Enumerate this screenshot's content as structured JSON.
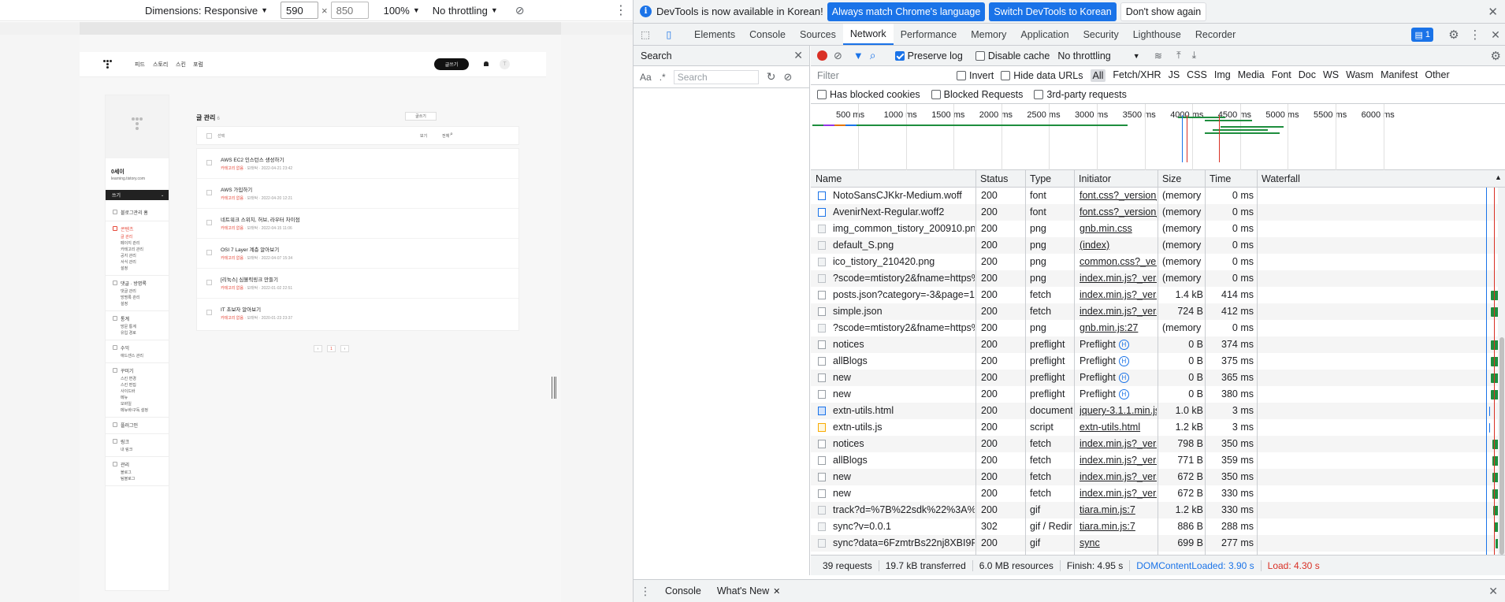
{
  "device_toolbar": {
    "dimensions_label": "Dimensions: Responsive",
    "width_value": "590",
    "height_placeholder": "850",
    "zoom": "100%",
    "throttling": "No throttling"
  },
  "tistory": {
    "nav": [
      "피드",
      "스토리",
      "스킨",
      "포럼"
    ],
    "write_button": "글쓰기",
    "avatar_letter": "T",
    "blog_name": "0세이",
    "blog_url": "learning.tistory.com",
    "write_bar": "쓰기",
    "sidebar": [
      {
        "title": "블로그관리 홈",
        "items": []
      },
      {
        "title": "콘텐츠",
        "active": true,
        "items": [
          "글 관리",
          "페이지 관리",
          "카테고리 관리",
          "공지 관리",
          "서식 관리",
          "설정"
        ]
      },
      {
        "title": "댓글 · 방명록",
        "items": [
          "댓글 관리",
          "방명록 관리",
          "설정"
        ]
      },
      {
        "title": "통계",
        "items": [
          "방문 통계",
          "유입 경로"
        ]
      },
      {
        "title": "수익",
        "items": [
          "애드센스 관리"
        ]
      },
      {
        "title": "꾸미기",
        "items": [
          "스킨 변경",
          "스킨 편집",
          "사이드바",
          "메뉴",
          "모바일",
          "메뉴바/구독 설정"
        ]
      },
      {
        "title": "플러그인",
        "items": []
      },
      {
        "title": "링크",
        "items": [
          "내 링크"
        ]
      },
      {
        "title": "관리",
        "items": [
          "블로그",
          "팀블로그"
        ]
      }
    ],
    "main_title": "글 관리",
    "main_count": "6",
    "sort_button": "글쓰기",
    "list_head": {
      "select": "선택",
      "view": "보기",
      "all": "전체"
    },
    "posts": [
      {
        "title": "AWS EC2 인스턴스 생성하기",
        "category": "카테고리 없음",
        "author": "모래탁",
        "date": "2022-04-21 23:42"
      },
      {
        "title": "AWS 가입하기",
        "category": "카테고리 없음",
        "author": "모래탁",
        "date": "2022-04-20 12:21"
      },
      {
        "title": "네트워크 스위치, 허브, 라우터 차이점",
        "category": "카테고리 없음",
        "author": "모래탁",
        "date": "2022-04-15 11:06"
      },
      {
        "title": "OSI 7 Layer 계층 알아보기",
        "category": "카테고리 없음",
        "author": "모래탁",
        "date": "2022-04-07 15:34"
      },
      {
        "title": "[리눅스] 심볼릭링크 만들기",
        "category": "카테고리 없음",
        "author": "모래탁",
        "date": "2022-01-02 22:51"
      },
      {
        "title": "IT 초보자 알아보기",
        "category": "카테고리 없음",
        "author": "모래탁",
        "date": "2020-01-23 23:37"
      }
    ],
    "pager": [
      "‹",
      "1",
      "›"
    ]
  },
  "infobar": {
    "message": "DevTools is now available in Korean!",
    "btn_match": "Always match Chrome's language",
    "btn_switch": "Switch DevTools to Korean",
    "btn_dismiss": "Don't show again"
  },
  "tabs": [
    "Elements",
    "Console",
    "Sources",
    "Network",
    "Performance",
    "Memory",
    "Application",
    "Security",
    "Lighthouse",
    "Recorder"
  ],
  "active_tab": "Network",
  "message_count": "1",
  "search_panel": {
    "title": "Search",
    "aa": "Aa",
    "regex": ".*",
    "placeholder": "Search"
  },
  "network_toolbar": {
    "preserve_log": "Preserve log",
    "disable_cache": "Disable cache",
    "throttling": "No throttling"
  },
  "filter": {
    "placeholder": "Filter",
    "invert": "Invert",
    "hide_data_urls": "Hide data URLs",
    "types": [
      "All",
      "Fetch/XHR",
      "JS",
      "CSS",
      "Img",
      "Media",
      "Font",
      "Doc",
      "WS",
      "Wasm",
      "Manifest",
      "Other"
    ],
    "has_blocked_cookies": "Has blocked cookies",
    "blocked_requests": "Blocked Requests",
    "third_party": "3rd-party requests"
  },
  "overview_ticks": [
    "500 ms",
    "1000 ms",
    "1500 ms",
    "2000 ms",
    "2500 ms",
    "3000 ms",
    "3500 ms",
    "4000 ms",
    "4500 ms",
    "5000 ms",
    "5500 ms",
    "6000 ms"
  ],
  "columns": {
    "name": "Name",
    "status": "Status",
    "type": "Type",
    "initiator": "Initiator",
    "size": "Size",
    "time": "Time",
    "waterfall": "Waterfall"
  },
  "requests": [
    {
      "name": "NotoSansCJKkr-Medium.woff",
      "status": "200",
      "type": "font",
      "initiator": "font.css?_version_=ti...",
      "size": "(memory c...",
      "time": "0 ms",
      "icon": "font"
    },
    {
      "name": "AvenirNext-Regular.woff2",
      "status": "200",
      "type": "font",
      "initiator": "font.css?_version_=ti...",
      "size": "(memory c...",
      "time": "0 ms",
      "icon": "font"
    },
    {
      "name": "img_common_tistory_200910.png",
      "status": "200",
      "type": "png",
      "initiator": "gnb.min.css",
      "size": "(memory c...",
      "time": "0 ms",
      "icon": "img"
    },
    {
      "name": "default_S.png",
      "status": "200",
      "type": "png",
      "initiator": "(index)",
      "size": "(memory c...",
      "time": "0 ms",
      "icon": "img"
    },
    {
      "name": "ico_tistory_210420.png",
      "status": "200",
      "type": "png",
      "initiator": "common.css?_versio...",
      "size": "(memory c...",
      "time": "0 ms",
      "icon": "img"
    },
    {
      "name": "?scode=mtistory2&fname=https%3A%2...",
      "status": "200",
      "type": "png",
      "initiator": "index.min.js?_versio...",
      "size": "(memory c...",
      "time": "0 ms",
      "icon": "img"
    },
    {
      "name": "posts.json?category=-3&page=1&searc...",
      "status": "200",
      "type": "fetch",
      "initiator": "index.min.js?_versio...",
      "size": "1.4 kB",
      "time": "414 ms",
      "icon": "plain"
    },
    {
      "name": "simple.json",
      "status": "200",
      "type": "fetch",
      "initiator": "index.min.js?_versio...",
      "size": "724 B",
      "time": "412 ms",
      "icon": "plain"
    },
    {
      "name": "?scode=mtistory2&fname=https%3A%2...",
      "status": "200",
      "type": "png",
      "initiator": "gnb.min.js:27",
      "size": "(memory c...",
      "time": "0 ms",
      "icon": "img"
    },
    {
      "name": "notices",
      "status": "200",
      "type": "preflight",
      "initiator": "Preflight",
      "size": "0 B",
      "time": "374 ms",
      "icon": "plain"
    },
    {
      "name": "allBlogs",
      "status": "200",
      "type": "preflight",
      "initiator": "Preflight",
      "size": "0 B",
      "time": "375 ms",
      "icon": "plain"
    },
    {
      "name": "new",
      "status": "200",
      "type": "preflight",
      "initiator": "Preflight",
      "size": "0 B",
      "time": "365 ms",
      "icon": "plain"
    },
    {
      "name": "new",
      "status": "200",
      "type": "preflight",
      "initiator": "Preflight",
      "size": "0 B",
      "time": "380 ms",
      "icon": "plain"
    },
    {
      "name": "extn-utils.html",
      "status": "200",
      "type": "document",
      "initiator": "jquery-3.1.1.min.js:3",
      "size": "1.0 kB",
      "time": "3 ms",
      "icon": "doc"
    },
    {
      "name": "extn-utils.js",
      "status": "200",
      "type": "script",
      "initiator": "extn-utils.html",
      "size": "1.2 kB",
      "time": "3 ms",
      "icon": "script"
    },
    {
      "name": "notices",
      "status": "200",
      "type": "fetch",
      "initiator": "index.min.js?_versio...",
      "size": "798 B",
      "time": "350 ms",
      "icon": "plain"
    },
    {
      "name": "allBlogs",
      "status": "200",
      "type": "fetch",
      "initiator": "index.min.js?_versio...",
      "size": "771 B",
      "time": "359 ms",
      "icon": "plain"
    },
    {
      "name": "new",
      "status": "200",
      "type": "fetch",
      "initiator": "index.min.js?_versio...",
      "size": "672 B",
      "time": "350 ms",
      "icon": "plain"
    },
    {
      "name": "new",
      "status": "200",
      "type": "fetch",
      "initiator": "index.min.js?_versio...",
      "size": "672 B",
      "time": "330 ms",
      "icon": "plain"
    },
    {
      "name": "track?d=%7B%22sdk%22%3A%7B%22ty...",
      "status": "200",
      "type": "gif",
      "initiator": "tiara.min.js:7",
      "size": "1.2 kB",
      "time": "330 ms",
      "icon": "img"
    },
    {
      "name": "sync?v=0.0.1",
      "status": "302",
      "type": "gif / Redire...",
      "initiator": "tiara.min.js:7",
      "size": "886 B",
      "time": "288 ms",
      "icon": "img"
    },
    {
      "name": "sync?data=6FzmtrBs22nj8XBI9R85c6Virs...",
      "status": "200",
      "type": "gif",
      "initiator": "sync",
      "size": "699 B",
      "time": "277 ms",
      "icon": "img"
    }
  ],
  "summary": {
    "requests": "39 requests",
    "transferred": "19.7 kB transferred",
    "resources": "6.0 MB resources",
    "finish": "Finish: 4.95 s",
    "dcl": "DOMContentLoaded: 3.90 s",
    "load": "Load: 4.30 s"
  },
  "drawer_tabs": [
    "Console",
    "What's New"
  ],
  "colors": {
    "accent": "#1a73e8",
    "record": "#d93025",
    "waterfall": "#1e8e3e",
    "tistory_red": "#e64a3b"
  }
}
